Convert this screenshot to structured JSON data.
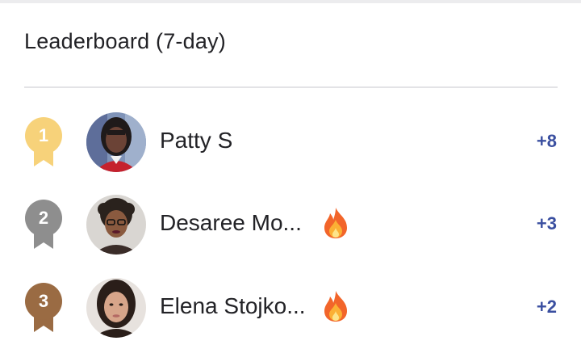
{
  "leaderboard": {
    "title": "Leaderboard (7-day)",
    "entries": [
      {
        "rank": "1",
        "name": "Patty S",
        "points": "+8",
        "fire": false,
        "medal_color": "#f7d27a"
      },
      {
        "rank": "2",
        "name": "Desaree Mo...",
        "points": "+3",
        "fire": true,
        "medal_color": "#8e8e8e"
      },
      {
        "rank": "3",
        "name": "Elena Stojko...",
        "points": "+2",
        "fire": true,
        "medal_color": "#9a6b43"
      }
    ]
  },
  "colors": {
    "points": "#3a4fa0",
    "text": "#222226",
    "divider": "#e3e3e6"
  },
  "icons": {
    "medal": "ribbon-medal-icon",
    "fire": "fire-icon"
  }
}
